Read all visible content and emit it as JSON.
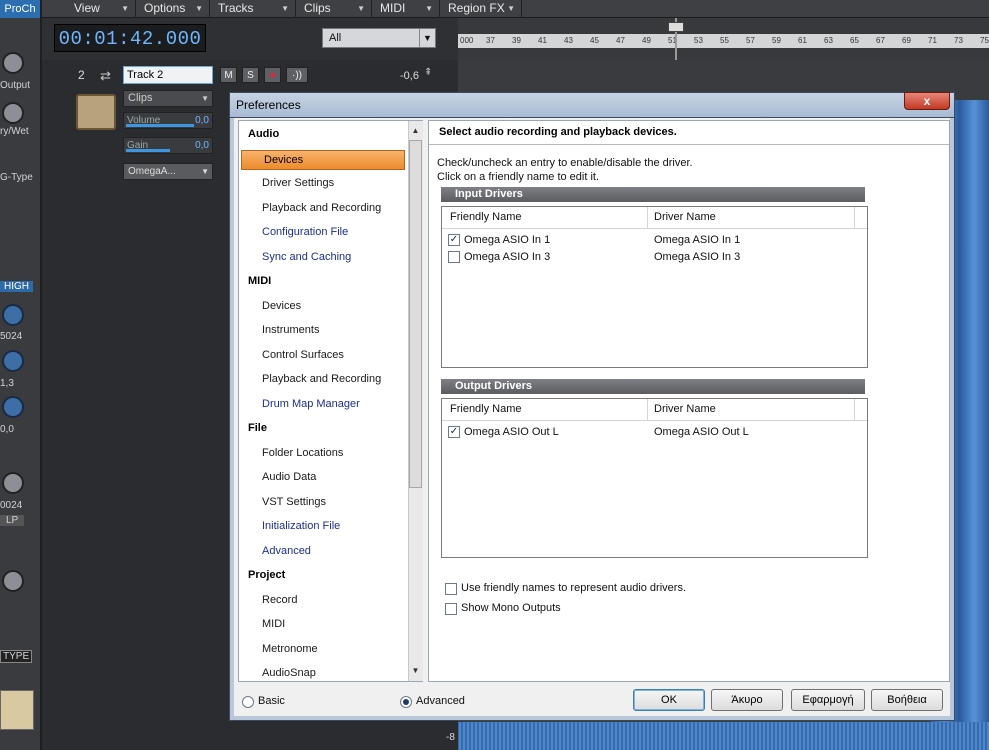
{
  "daw": {
    "proch_label": "ProCh",
    "strip_labels": [
      "Output",
      "ry/Wet",
      "G-Type",
      "HIGH",
      "5024",
      "1,3",
      "0,0",
      "0024",
      "LP",
      "TYPE"
    ],
    "menus": [
      "View",
      "Options",
      "Tracks",
      "Clips",
      "MIDI",
      "Region FX"
    ],
    "timecode": "00:01:42.000",
    "filter_dropdown": "All",
    "ruler_ticks": [
      "000",
      "37",
      "39",
      "41",
      "43",
      "45",
      "47",
      "49",
      "51",
      "53",
      "55",
      "57",
      "59",
      "61",
      "63",
      "65",
      "67",
      "69",
      "71",
      "73",
      "75"
    ],
    "track": {
      "number": "2",
      "name": "Track 2",
      "buttons": [
        "M",
        "S",
        "●",
        "·))"
      ],
      "volume_db": "-0,6",
      "clips_dropdown": "Clips",
      "volume_label": "Volume",
      "volume_value": "0,0",
      "gain_label": "Gain",
      "gain_value": "0,0",
      "input_dropdown": "OmegaA..."
    },
    "wave_marker": "-8"
  },
  "dialog": {
    "title": "Preferences",
    "close_label": "x",
    "nav": [
      {
        "type": "head",
        "label": "Audio"
      },
      {
        "type": "item",
        "label": "Devices",
        "selected": true
      },
      {
        "type": "item",
        "label": "Driver Settings"
      },
      {
        "type": "item",
        "label": "Playback and Recording"
      },
      {
        "type": "link",
        "label": "Configuration File"
      },
      {
        "type": "link",
        "label": "Sync and Caching"
      },
      {
        "type": "head",
        "label": "MIDI"
      },
      {
        "type": "item",
        "label": "Devices"
      },
      {
        "type": "item",
        "label": "Instruments"
      },
      {
        "type": "item",
        "label": "Control Surfaces"
      },
      {
        "type": "item",
        "label": "Playback and Recording"
      },
      {
        "type": "link",
        "label": "Drum Map Manager"
      },
      {
        "type": "head",
        "label": "File"
      },
      {
        "type": "item",
        "label": "Folder Locations"
      },
      {
        "type": "item",
        "label": "Audio Data"
      },
      {
        "type": "item",
        "label": "VST Settings"
      },
      {
        "type": "link",
        "label": "Initialization File"
      },
      {
        "type": "link",
        "label": "Advanced"
      },
      {
        "type": "head",
        "label": "Project"
      },
      {
        "type": "item",
        "label": "Record"
      },
      {
        "type": "item",
        "label": "MIDI"
      },
      {
        "type": "item",
        "label": "Metronome"
      },
      {
        "type": "item",
        "label": "AudioSnap"
      }
    ],
    "heading": "Select audio recording and playback devices.",
    "desc_line1": "Check/uncheck an entry to enable/disable the driver.",
    "desc_line2": "Click on a friendly name to edit it.",
    "input_drivers": {
      "title": "Input Drivers",
      "col_friendly": "Friendly Name",
      "col_driver": "Driver Name",
      "rows": [
        {
          "friendly": "Omega ASIO In 1",
          "driver": "Omega ASIO In 1",
          "checked": true
        },
        {
          "friendly": "Omega ASIO In 3",
          "driver": "Omega ASIO In 3",
          "checked": false
        }
      ]
    },
    "output_drivers": {
      "title": "Output Drivers",
      "col_friendly": "Friendly Name",
      "col_driver": "Driver Name",
      "rows": [
        {
          "friendly": "Omega ASIO Out L",
          "driver": "Omega ASIO Out L",
          "checked": true
        }
      ]
    },
    "opt_friendly_names": {
      "label": "Use friendly names to represent audio drivers.",
      "checked": false
    },
    "opt_mono_outputs": {
      "label": "Show Mono Outputs",
      "checked": false
    },
    "mode_basic": "Basic",
    "mode_advanced": "Advanced",
    "mode_selected": "Advanced",
    "buttons": {
      "ok": "OK",
      "cancel": "Άκυρο",
      "apply": "Εφαρμογή",
      "help": "Βοήθεια"
    }
  }
}
